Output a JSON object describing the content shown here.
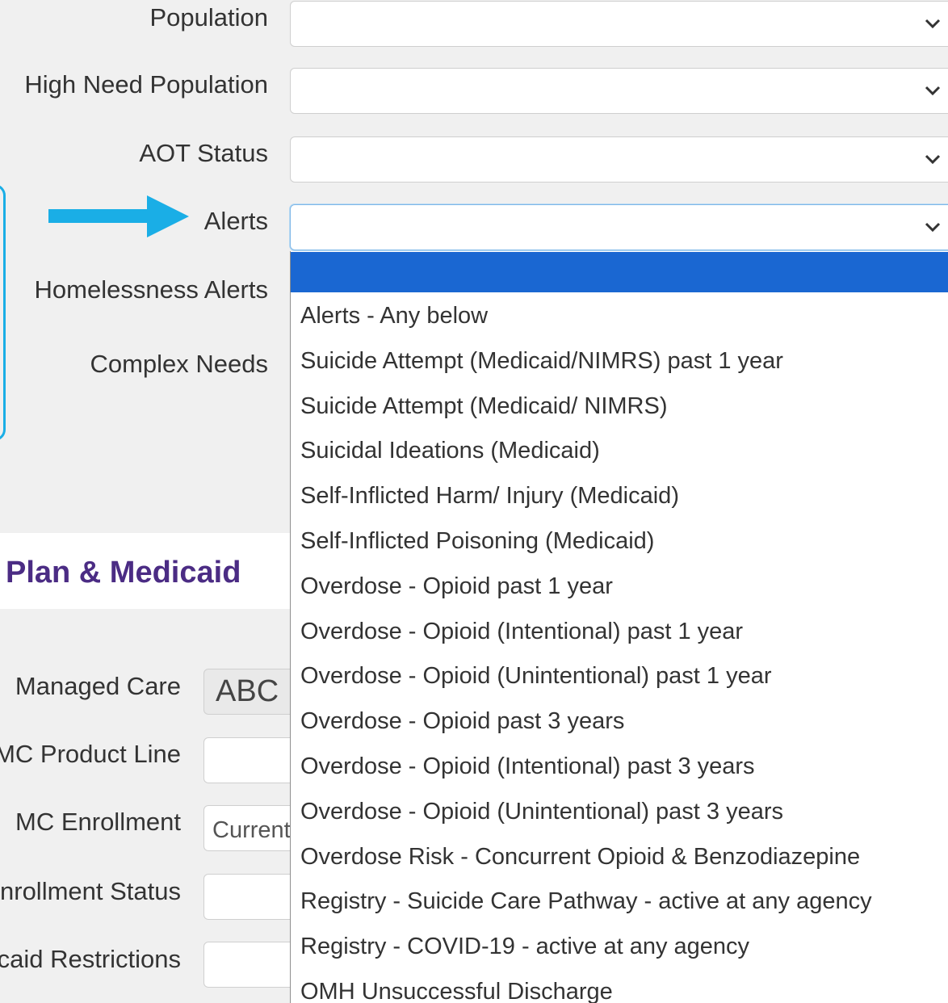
{
  "form": {
    "population_label": "Population",
    "high_need_label": "High Need Population",
    "aot_label": "AOT Status",
    "alerts_label": "Alerts",
    "homelessness_label": "Homelessness Alerts",
    "complex_needs_label": "Complex Needs"
  },
  "section": {
    "title": "Plan & Medicaid"
  },
  "plan": {
    "managed_care_label": "Managed Care",
    "managed_care_value": "ABC",
    "mc_product_line_label": "MC Product Line",
    "mc_enrollment_label": "MC Enrollment",
    "mc_enrollment_value": "Current",
    "enrollment_status_label": "Enrollment Status",
    "restrictions_label": "Medicaid Restrictions"
  },
  "alerts_dropdown": {
    "selected_value": "",
    "options": [
      "Alerts - Any below",
      "Suicide Attempt (Medicaid/NIMRS) past 1 year",
      "Suicide Attempt (Medicaid/ NIMRS)",
      "Suicidal Ideations (Medicaid)",
      "Self-Inflicted Harm/ Injury (Medicaid)",
      "Self-Inflicted Poisoning (Medicaid)",
      "Overdose - Opioid past 1 year",
      "Overdose - Opioid (Intentional) past 1 year",
      "Overdose - Opioid (Unintentional) past 1 year",
      "Overdose - Opioid past 3 years",
      "Overdose - Opioid (Intentional) past 3 years",
      "Overdose - Opioid (Unintentional) past 3 years",
      "Overdose Risk - Concurrent Opioid & Benzodiazepine",
      "Registry - Suicide Care Pathway - active at any agency",
      "Registry - COVID-19 - active at any agency",
      "OMH Unsuccessful Discharge"
    ]
  },
  "icons": {
    "dropdown": "chevron-down-icon",
    "pointer": "arrow-right-icon"
  },
  "colors": {
    "highlight": "#1a67d2",
    "annotation": "#1aaee6",
    "section_title": "#4b2c84"
  }
}
